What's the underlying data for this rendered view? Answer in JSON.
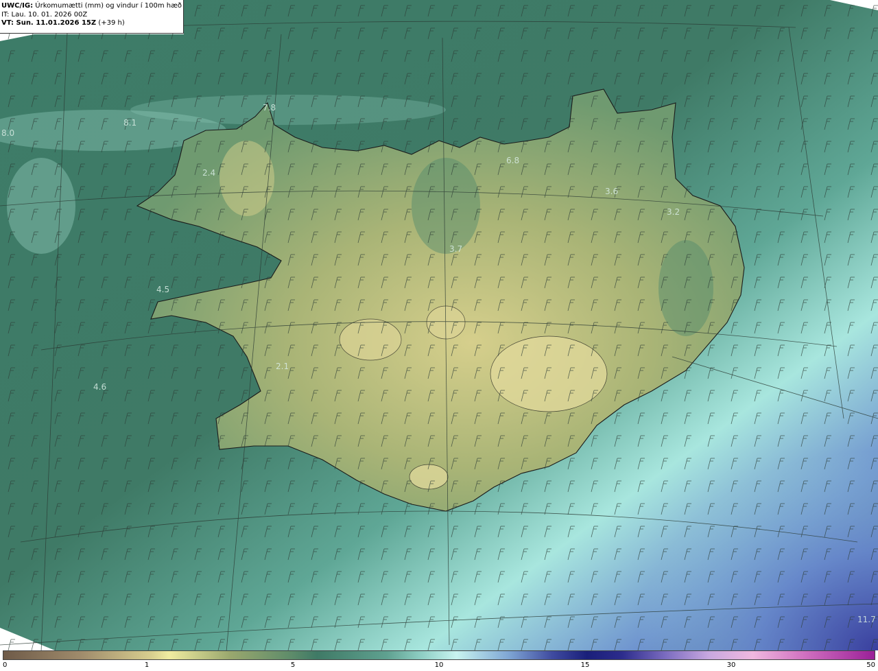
{
  "header": {
    "title_bold": "UWC/IG:",
    "title_rest": " Úrkomumætti (mm) og vindur í 100m hæð",
    "initial_time": "IT: Lau. 10. 01. 2026 00Z",
    "valid_time_bold": "VT: Sun. 11.01.2026 15Z",
    "valid_time_rest": " (+39 h)"
  },
  "map_labels": [
    {
      "text": "7.8"
    },
    {
      "text": "8.1"
    },
    {
      "text": "8.0"
    },
    {
      "text": "2.4"
    },
    {
      "text": "6.8"
    },
    {
      "text": "3.6"
    },
    {
      "text": "3.2"
    },
    {
      "text": "3.7"
    },
    {
      "text": "4.5"
    },
    {
      "text": "2.1"
    },
    {
      "text": "4.6"
    },
    {
      "text": "11.7"
    }
  ],
  "colorbar": {
    "ticks": [
      "0",
      "1",
      "5",
      "10",
      "15",
      "30",
      "50"
    ]
  },
  "colors": {
    "sea_green": "#3f7a66",
    "land_yellow": "#d8cf8f",
    "high_blue": "#3f4ba0",
    "coast": "#1a1a1a"
  }
}
